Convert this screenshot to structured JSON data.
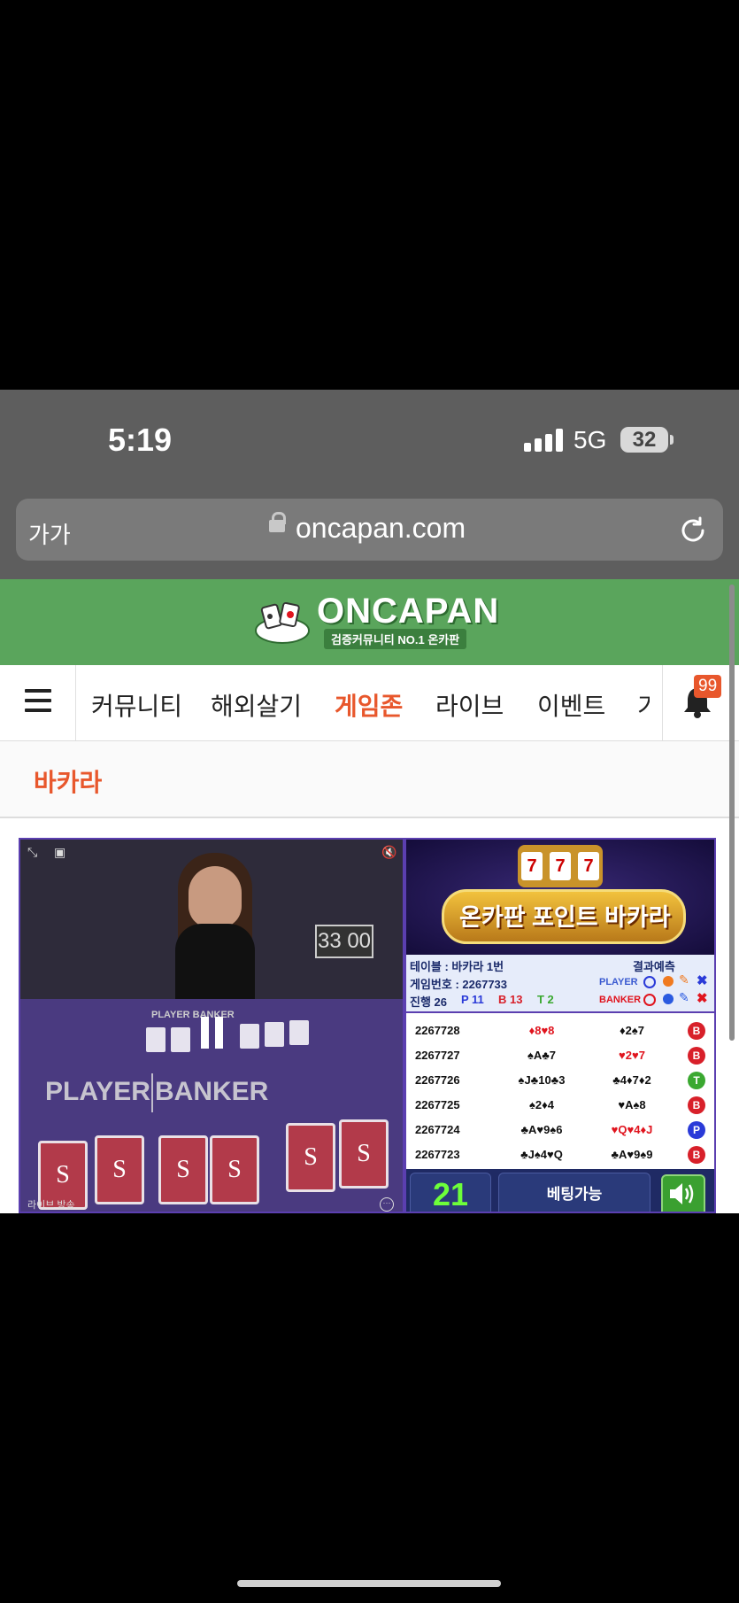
{
  "status_bar": {
    "time": "5:19",
    "network": "5G",
    "battery": "32"
  },
  "browser": {
    "text_size_button": "가가",
    "url": "oncapan.com"
  },
  "site": {
    "logo_text": "ONCAPAN",
    "logo_tagline": "검증커뮤니티 NO.1 온카판",
    "nav_items": [
      {
        "label": "커뮤니티",
        "active": false
      },
      {
        "label": "해외살기",
        "active": false
      },
      {
        "label": "게임존",
        "active": true
      },
      {
        "label": "라이브",
        "active": false
      },
      {
        "label": "이벤트",
        "active": false
      },
      {
        "label": "기",
        "active": false
      }
    ],
    "notification_count": "99",
    "page_title": "바카라",
    "brand_color": "#5aa55c",
    "accent_color": "#e8572c"
  },
  "video": {
    "timer": "33 00",
    "player_label": "PLAYER",
    "banker_label": "BANKER",
    "table_label": "PLAYER  BANKER",
    "card_brand": "SKY",
    "live_label": "라이브 방송"
  },
  "game_panel": {
    "banner_title": "온카판 포인트 바카라",
    "slot_digits": [
      "7",
      "7",
      "7"
    ],
    "table_label": "테이블 : 바카라 1번",
    "prediction_label": "결과예측",
    "game_number": "게임번호 : 2267733",
    "progress_label": "진행 26",
    "player_count": "P 11",
    "banker_count": "B 13",
    "tie_count": "T 2",
    "player_pred_label": "PLAYER",
    "banker_pred_label": "BANKER",
    "rows": [
      {
        "id": "2267728",
        "player": "♦8♥8",
        "banker": "♦2♠7",
        "result": "B"
      },
      {
        "id": "2267727",
        "player": "♠A♣7",
        "banker": "♥2♥7",
        "result": "B"
      },
      {
        "id": "2267726",
        "player": "♠J♣10♣3",
        "banker": "♣4♦7♦2",
        "result": "T"
      },
      {
        "id": "2267725",
        "player": "♠2♦4",
        "banker": "♥A♠8",
        "result": "B"
      },
      {
        "id": "2267724",
        "player": "♣A♥9♠6",
        "banker": "♥Q♥4♦J",
        "result": "P"
      },
      {
        "id": "2267723",
        "player": "♣J♠4♥Q",
        "banker": "♣A♥9♠9",
        "result": "B"
      }
    ],
    "countdown": "21",
    "betting_status": "베팅가능",
    "result_colors": {
      "B": "#d8202a",
      "P": "#2a3ad8",
      "T": "#3aa830"
    }
  }
}
